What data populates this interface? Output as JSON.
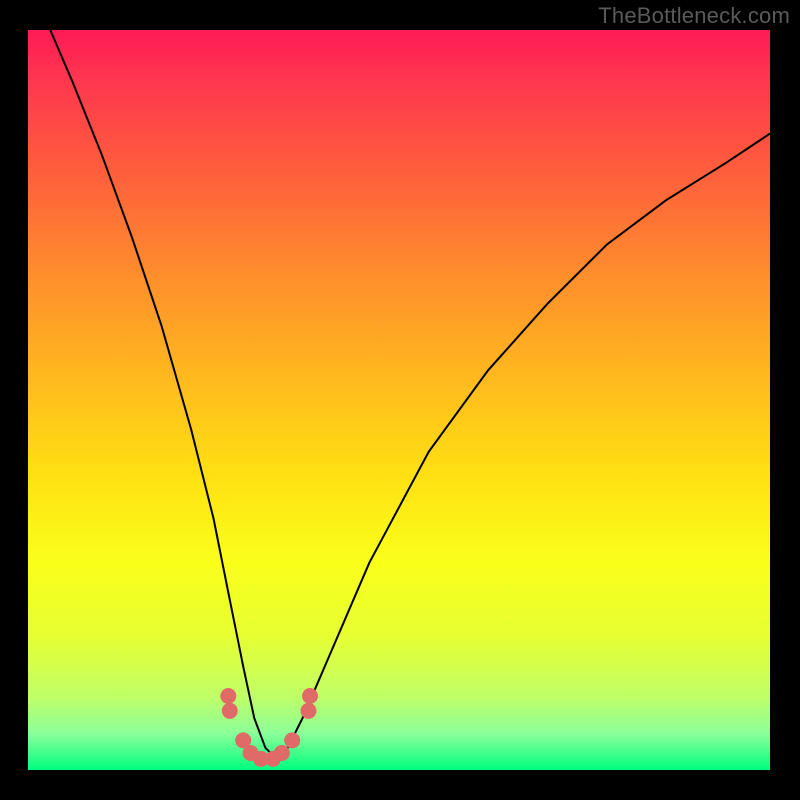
{
  "watermark": "TheBottleneck.com",
  "chart_data": {
    "type": "line",
    "title": "",
    "xlabel": "",
    "ylabel": "",
    "xlim": [
      0,
      100
    ],
    "ylim": [
      0,
      100
    ],
    "grid": false,
    "legend": false,
    "series": [
      {
        "name": "curve",
        "x": [
          3,
          6,
          10,
          14,
          18,
          22,
          25,
          27,
          29,
          30.5,
          32,
          33.5,
          35,
          37,
          40,
          46,
          54,
          62,
          70,
          78,
          86,
          94,
          100
        ],
        "values": [
          100,
          93,
          83,
          72,
          60,
          46,
          34,
          24,
          14,
          7,
          3,
          1.5,
          3,
          7,
          14,
          28,
          43,
          54,
          63,
          71,
          77,
          82,
          86
        ]
      }
    ],
    "markers": [
      {
        "x": 27.0,
        "y": 10.0
      },
      {
        "x": 27.2,
        "y": 8.0
      },
      {
        "x": 29.0,
        "y": 4.0
      },
      {
        "x": 30.0,
        "y": 2.3
      },
      {
        "x": 31.4,
        "y": 1.5
      },
      {
        "x": 33.0,
        "y": 1.5
      },
      {
        "x": 34.2,
        "y": 2.3
      },
      {
        "x": 35.6,
        "y": 4.0
      },
      {
        "x": 37.8,
        "y": 8.0
      },
      {
        "x": 38.0,
        "y": 10.0
      }
    ],
    "marker_radius_px": 8
  }
}
